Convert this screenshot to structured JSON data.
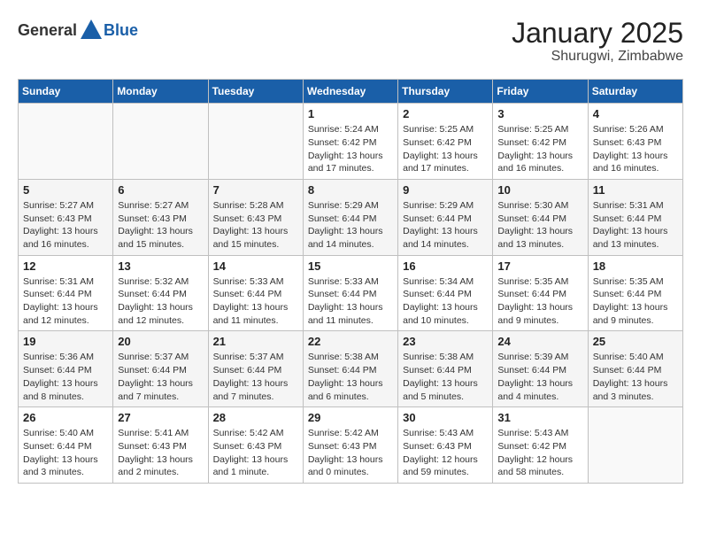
{
  "header": {
    "logo_general": "General",
    "logo_blue": "Blue",
    "title": "January 2025",
    "subtitle": "Shurugwi, Zimbabwe"
  },
  "weekdays": [
    "Sunday",
    "Monday",
    "Tuesday",
    "Wednesday",
    "Thursday",
    "Friday",
    "Saturday"
  ],
  "weeks": [
    [
      {
        "day": "",
        "info": ""
      },
      {
        "day": "",
        "info": ""
      },
      {
        "day": "",
        "info": ""
      },
      {
        "day": "1",
        "info": "Sunrise: 5:24 AM\nSunset: 6:42 PM\nDaylight: 13 hours\nand 17 minutes."
      },
      {
        "day": "2",
        "info": "Sunrise: 5:25 AM\nSunset: 6:42 PM\nDaylight: 13 hours\nand 17 minutes."
      },
      {
        "day": "3",
        "info": "Sunrise: 5:25 AM\nSunset: 6:42 PM\nDaylight: 13 hours\nand 16 minutes."
      },
      {
        "day": "4",
        "info": "Sunrise: 5:26 AM\nSunset: 6:43 PM\nDaylight: 13 hours\nand 16 minutes."
      }
    ],
    [
      {
        "day": "5",
        "info": "Sunrise: 5:27 AM\nSunset: 6:43 PM\nDaylight: 13 hours\nand 16 minutes."
      },
      {
        "day": "6",
        "info": "Sunrise: 5:27 AM\nSunset: 6:43 PM\nDaylight: 13 hours\nand 15 minutes."
      },
      {
        "day": "7",
        "info": "Sunrise: 5:28 AM\nSunset: 6:43 PM\nDaylight: 13 hours\nand 15 minutes."
      },
      {
        "day": "8",
        "info": "Sunrise: 5:29 AM\nSunset: 6:44 PM\nDaylight: 13 hours\nand 14 minutes."
      },
      {
        "day": "9",
        "info": "Sunrise: 5:29 AM\nSunset: 6:44 PM\nDaylight: 13 hours\nand 14 minutes."
      },
      {
        "day": "10",
        "info": "Sunrise: 5:30 AM\nSunset: 6:44 PM\nDaylight: 13 hours\nand 13 minutes."
      },
      {
        "day": "11",
        "info": "Sunrise: 5:31 AM\nSunset: 6:44 PM\nDaylight: 13 hours\nand 13 minutes."
      }
    ],
    [
      {
        "day": "12",
        "info": "Sunrise: 5:31 AM\nSunset: 6:44 PM\nDaylight: 13 hours\nand 12 minutes."
      },
      {
        "day": "13",
        "info": "Sunrise: 5:32 AM\nSunset: 6:44 PM\nDaylight: 13 hours\nand 12 minutes."
      },
      {
        "day": "14",
        "info": "Sunrise: 5:33 AM\nSunset: 6:44 PM\nDaylight: 13 hours\nand 11 minutes."
      },
      {
        "day": "15",
        "info": "Sunrise: 5:33 AM\nSunset: 6:44 PM\nDaylight: 13 hours\nand 11 minutes."
      },
      {
        "day": "16",
        "info": "Sunrise: 5:34 AM\nSunset: 6:44 PM\nDaylight: 13 hours\nand 10 minutes."
      },
      {
        "day": "17",
        "info": "Sunrise: 5:35 AM\nSunset: 6:44 PM\nDaylight: 13 hours\nand 9 minutes."
      },
      {
        "day": "18",
        "info": "Sunrise: 5:35 AM\nSunset: 6:44 PM\nDaylight: 13 hours\nand 9 minutes."
      }
    ],
    [
      {
        "day": "19",
        "info": "Sunrise: 5:36 AM\nSunset: 6:44 PM\nDaylight: 13 hours\nand 8 minutes."
      },
      {
        "day": "20",
        "info": "Sunrise: 5:37 AM\nSunset: 6:44 PM\nDaylight: 13 hours\nand 7 minutes."
      },
      {
        "day": "21",
        "info": "Sunrise: 5:37 AM\nSunset: 6:44 PM\nDaylight: 13 hours\nand 7 minutes."
      },
      {
        "day": "22",
        "info": "Sunrise: 5:38 AM\nSunset: 6:44 PM\nDaylight: 13 hours\nand 6 minutes."
      },
      {
        "day": "23",
        "info": "Sunrise: 5:38 AM\nSunset: 6:44 PM\nDaylight: 13 hours\nand 5 minutes."
      },
      {
        "day": "24",
        "info": "Sunrise: 5:39 AM\nSunset: 6:44 PM\nDaylight: 13 hours\nand 4 minutes."
      },
      {
        "day": "25",
        "info": "Sunrise: 5:40 AM\nSunset: 6:44 PM\nDaylight: 13 hours\nand 3 minutes."
      }
    ],
    [
      {
        "day": "26",
        "info": "Sunrise: 5:40 AM\nSunset: 6:44 PM\nDaylight: 13 hours\nand 3 minutes."
      },
      {
        "day": "27",
        "info": "Sunrise: 5:41 AM\nSunset: 6:43 PM\nDaylight: 13 hours\nand 2 minutes."
      },
      {
        "day": "28",
        "info": "Sunrise: 5:42 AM\nSunset: 6:43 PM\nDaylight: 13 hours\nand 1 minute."
      },
      {
        "day": "29",
        "info": "Sunrise: 5:42 AM\nSunset: 6:43 PM\nDaylight: 13 hours\nand 0 minutes."
      },
      {
        "day": "30",
        "info": "Sunrise: 5:43 AM\nSunset: 6:43 PM\nDaylight: 12 hours\nand 59 minutes."
      },
      {
        "day": "31",
        "info": "Sunrise: 5:43 AM\nSunset: 6:42 PM\nDaylight: 12 hours\nand 58 minutes."
      },
      {
        "day": "",
        "info": ""
      }
    ]
  ]
}
